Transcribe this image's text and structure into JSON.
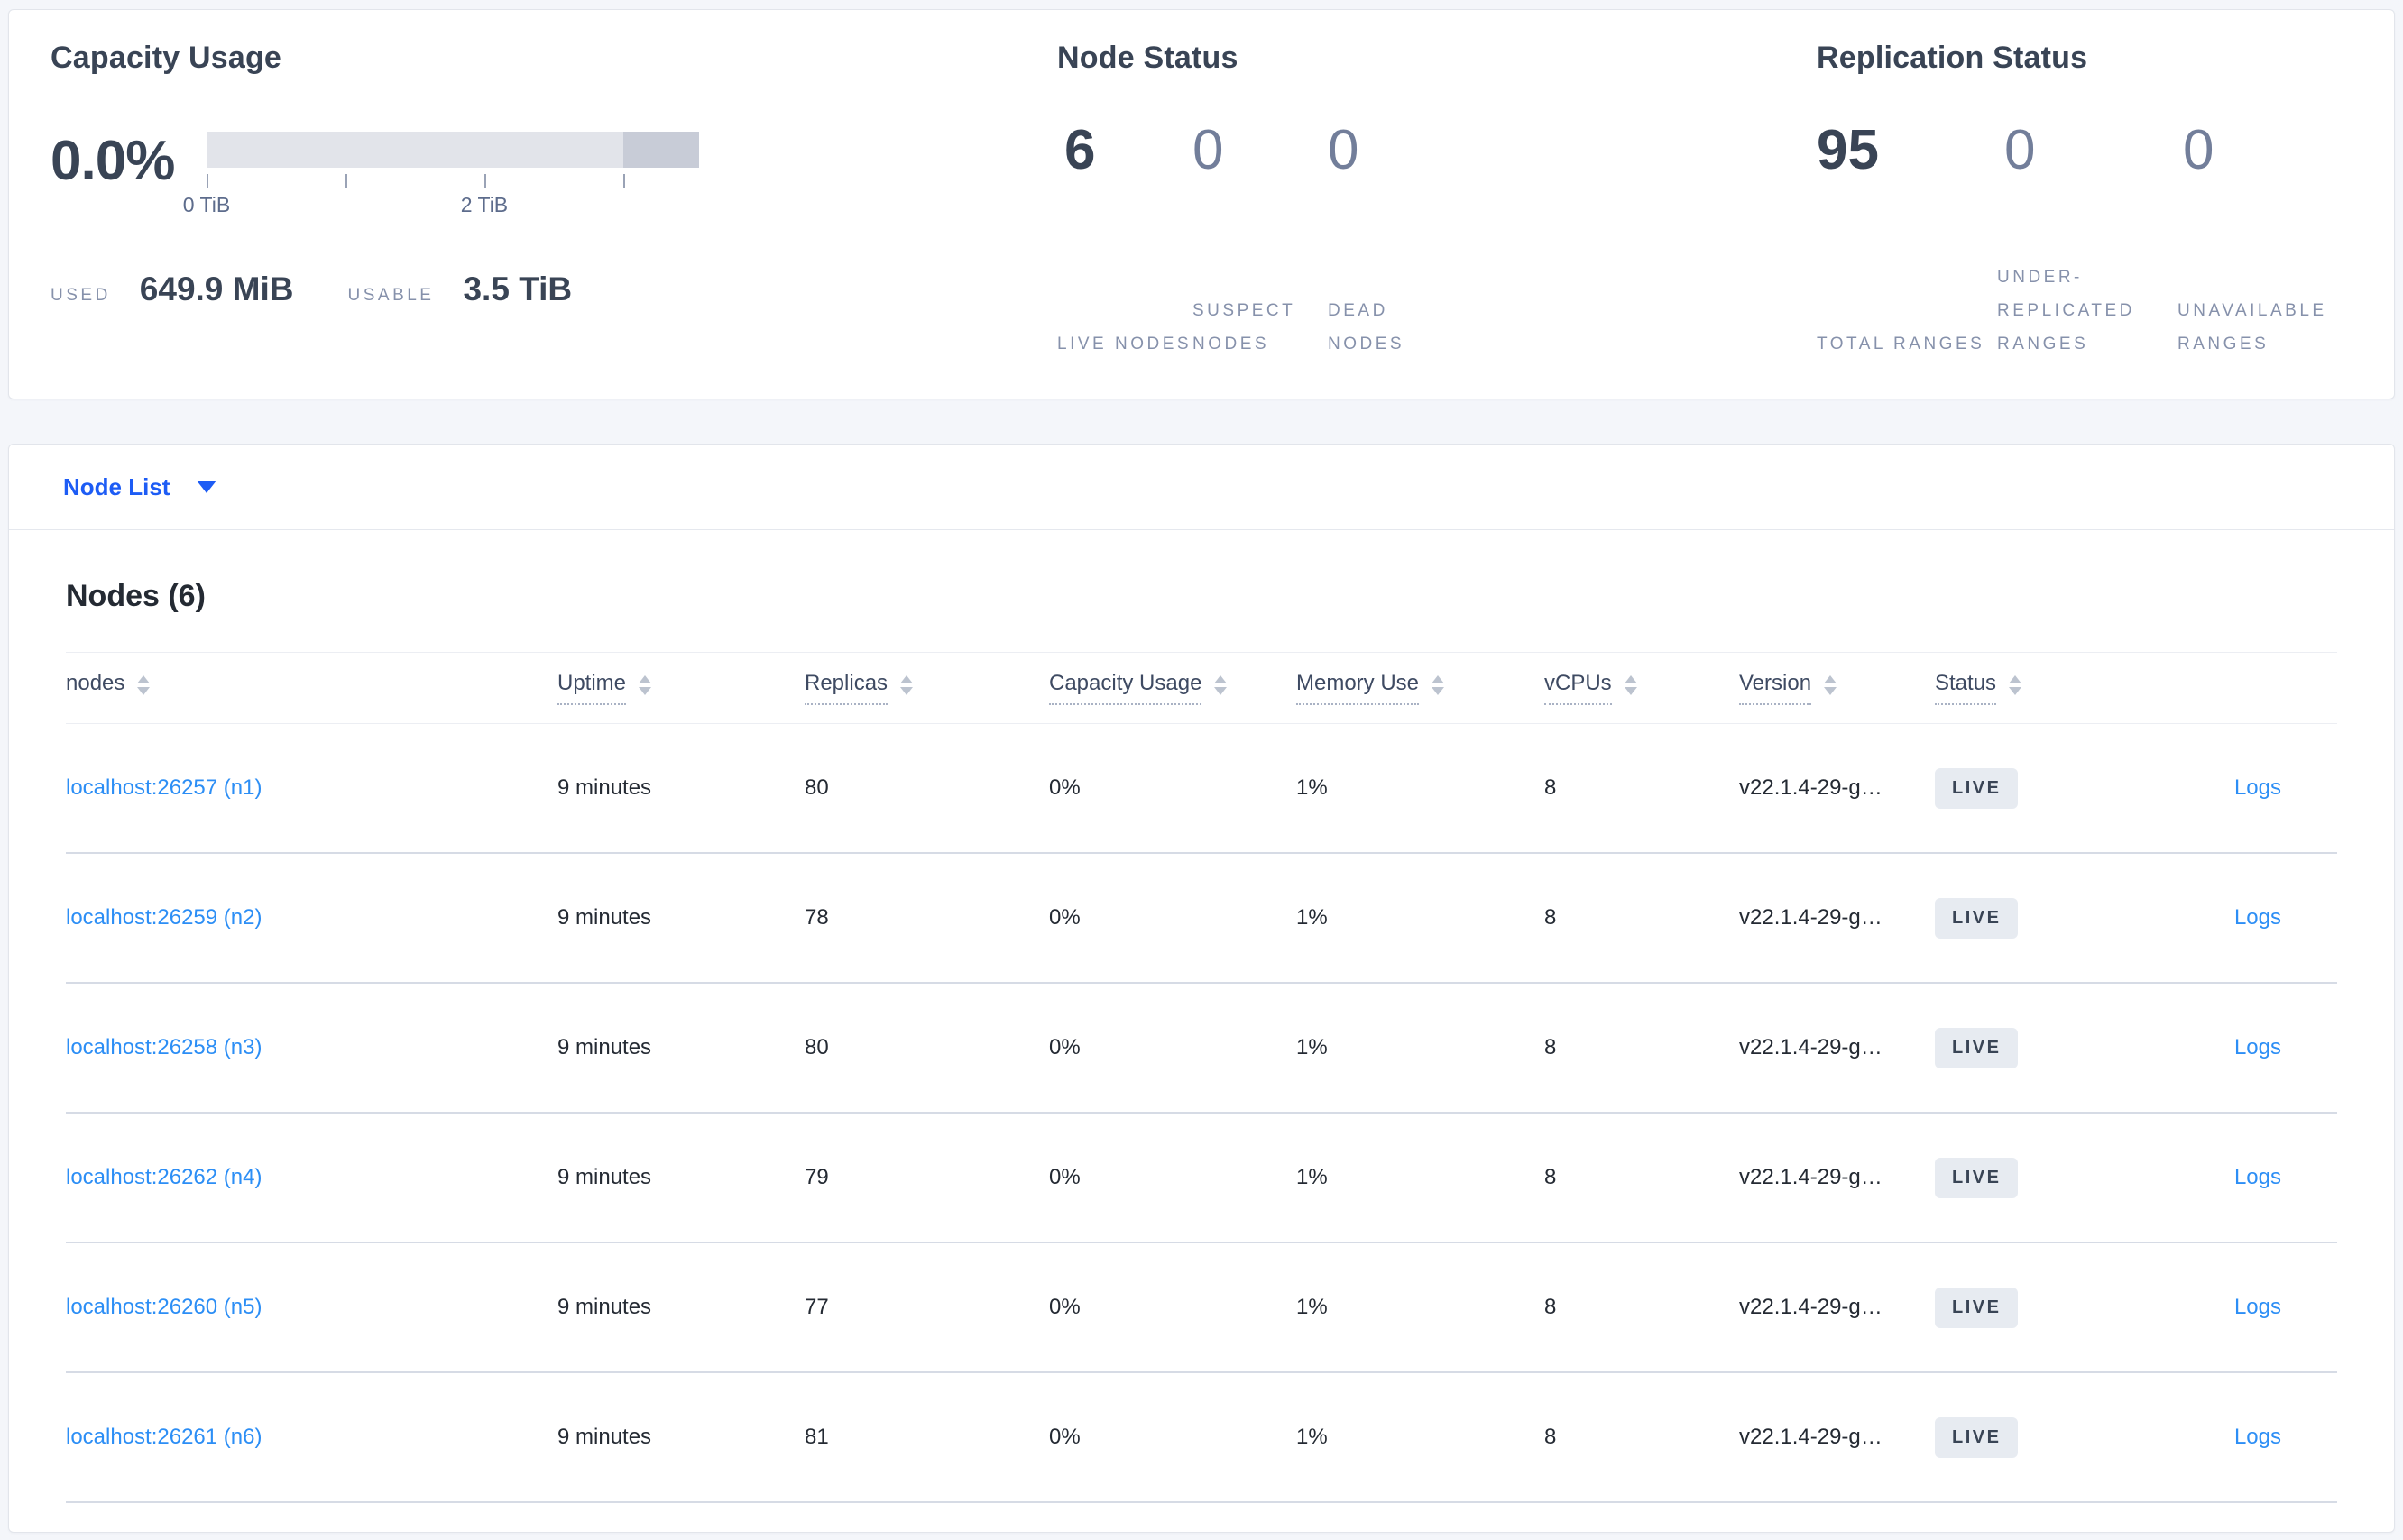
{
  "summary": {
    "capacity": {
      "title": "Capacity Usage",
      "percent": "0.0%",
      "bar": {
        "light_color": "#e2e4ea",
        "dark_color": "#c8ccd7",
        "dark_fraction_pct": 15.3,
        "tick_positions_pct": [
          0,
          28.2,
          56.4,
          84.6
        ],
        "tick_labels": [
          {
            "text": "0 TiB",
            "pos_pct": 0
          },
          {
            "text": "2 TiB",
            "pos_pct": 56.4
          }
        ]
      },
      "used_label": "USED",
      "used_value": "649.9 MiB",
      "usable_label": "USABLE",
      "usable_value": "3.5 TiB"
    },
    "node_status": {
      "title": "Node Status",
      "stats": [
        {
          "value": "6",
          "label": "LIVE NODES",
          "emphasis": true
        },
        {
          "value": "0",
          "label": "SUSPECT NODES",
          "emphasis": false
        },
        {
          "value": "0",
          "label": "DEAD NODES",
          "emphasis": false
        }
      ]
    },
    "replication": {
      "title": "Replication Status",
      "stats": [
        {
          "value": "95",
          "label": "TOTAL RANGES",
          "emphasis": true
        },
        {
          "value": "0",
          "label": "UNDER-REPLICATED RANGES",
          "emphasis": false
        },
        {
          "value": "0",
          "label": "UNAVAILABLE RANGES",
          "emphasis": false
        }
      ]
    }
  },
  "view_selector": {
    "label": "Node List"
  },
  "nodes_table": {
    "title": "Nodes (6)",
    "columns": [
      {
        "label": "nodes",
        "underlined": false
      },
      {
        "label": "Uptime",
        "underlined": true
      },
      {
        "label": "Replicas",
        "underlined": true
      },
      {
        "label": "Capacity Usage",
        "underlined": true
      },
      {
        "label": "Memory Use",
        "underlined": true
      },
      {
        "label": "vCPUs",
        "underlined": true
      },
      {
        "label": "Version",
        "underlined": true
      },
      {
        "label": "Status",
        "underlined": true
      },
      {
        "label": "",
        "underlined": false
      }
    ],
    "rows": [
      {
        "address": "localhost:26257 (n1)",
        "uptime": "9 minutes",
        "replicas": "80",
        "capacity": "0%",
        "memory": "1%",
        "vcpus": "8",
        "version": "v22.1.4-29-g…",
        "status": "LIVE",
        "logs": "Logs"
      },
      {
        "address": "localhost:26259 (n2)",
        "uptime": "9 minutes",
        "replicas": "78",
        "capacity": "0%",
        "memory": "1%",
        "vcpus": "8",
        "version": "v22.1.4-29-g…",
        "status": "LIVE",
        "logs": "Logs"
      },
      {
        "address": "localhost:26258 (n3)",
        "uptime": "9 minutes",
        "replicas": "80",
        "capacity": "0%",
        "memory": "1%",
        "vcpus": "8",
        "version": "v22.1.4-29-g…",
        "status": "LIVE",
        "logs": "Logs"
      },
      {
        "address": "localhost:26262 (n4)",
        "uptime": "9 minutes",
        "replicas": "79",
        "capacity": "0%",
        "memory": "1%",
        "vcpus": "8",
        "version": "v22.1.4-29-g…",
        "status": "LIVE",
        "logs": "Logs"
      },
      {
        "address": "localhost:26260 (n5)",
        "uptime": "9 minutes",
        "replicas": "77",
        "capacity": "0%",
        "memory": "1%",
        "vcpus": "8",
        "version": "v22.1.4-29-g…",
        "status": "LIVE",
        "logs": "Logs"
      },
      {
        "address": "localhost:26261 (n6)",
        "uptime": "9 minutes",
        "replicas": "81",
        "capacity": "0%",
        "memory": "1%",
        "vcpus": "8",
        "version": "v22.1.4-29-g…",
        "status": "LIVE",
        "logs": "Logs"
      }
    ]
  },
  "colors": {
    "page_background": "#f4f6fa",
    "card_border": "#e2e5eb",
    "title_text": "#394455",
    "muted_label": "#8691ab",
    "table_text": "#242a33",
    "table_link": "#2c8ef5",
    "selector_link": "#1d5cf5",
    "badge_background": "#e7ebf1",
    "row_divider": "#d6dbe5",
    "bar_light": "#e2e4ea",
    "bar_dark": "#c8ccd7"
  }
}
